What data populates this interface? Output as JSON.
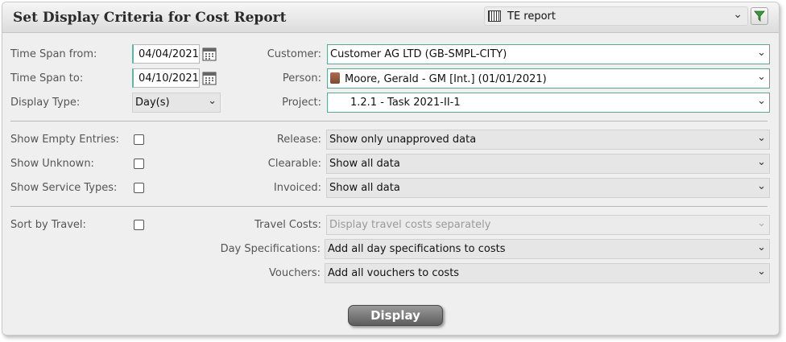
{
  "title": "Set Display Criteria for Cost Report",
  "report_selector": {
    "value": "TE report",
    "icon": "report-list-icon"
  },
  "filter_button": {
    "icon": "filter-icon",
    "accent": "#3c9a3c"
  },
  "criteria": {
    "time_span_from": {
      "label": "Time Span from:",
      "value": "04/04/2021"
    },
    "time_span_to": {
      "label": "Time Span to:",
      "value": "04/10/2021"
    },
    "display_type": {
      "label": "Display Type:",
      "value": "Day(s)"
    },
    "customer": {
      "label": "Customer:",
      "value": "Customer AG LTD (GB-SMPL-CITY)"
    },
    "person": {
      "label": "Person:",
      "value": "Moore, Gerald - GM [Int.] (01/01/2021)"
    },
    "project": {
      "label": "Project:",
      "value": "1.2.1 - Task 2021-II-1"
    }
  },
  "options": {
    "show_empty_entries": {
      "label": "Show Empty Entries:",
      "checked": false
    },
    "show_unknown": {
      "label": "Show Unknown:",
      "checked": false
    },
    "show_service_types": {
      "label": "Show Service Types:",
      "checked": false
    },
    "release": {
      "label": "Release:",
      "value": "Show only unapproved data"
    },
    "clearable": {
      "label": "Clearable:",
      "value": "Show all data"
    },
    "invoiced": {
      "label": "Invoiced:",
      "value": "Show all data"
    }
  },
  "travel": {
    "sort_by_travel": {
      "label": "Sort by Travel:",
      "checked": false
    },
    "travel_costs": {
      "label": "Travel Costs:",
      "value": "Display travel costs separately",
      "disabled": true
    },
    "day_specifications": {
      "label": "Day Specifications:",
      "value": "Add all day specifications to costs"
    },
    "vouchers": {
      "label": "Vouchers:",
      "value": "Add all vouchers to costs"
    }
  },
  "display_button": {
    "label": "Display"
  },
  "colors": {
    "field_accent": "#5aa892",
    "panel_bg": "#efefef"
  }
}
